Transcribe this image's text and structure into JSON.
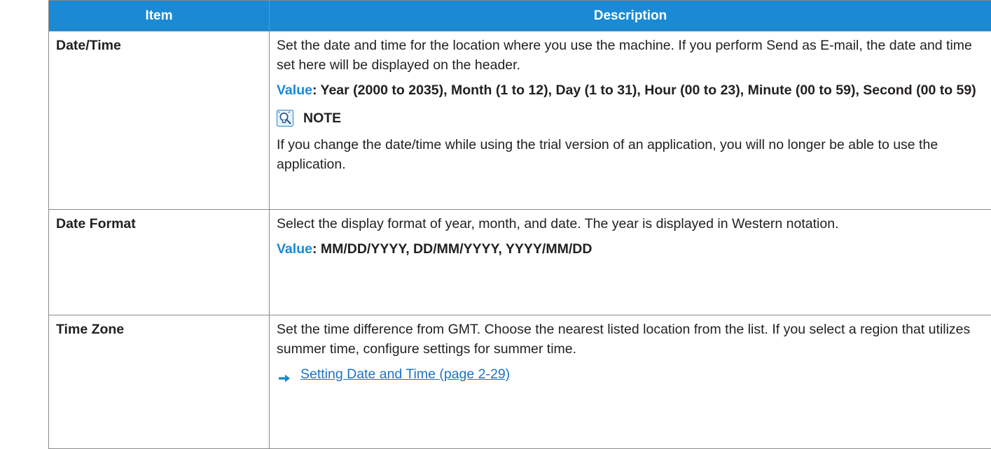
{
  "table": {
    "headers": {
      "item": "Item",
      "description": "Description"
    },
    "rows": [
      {
        "item": "Date/Time",
        "description": "Set the date and time for the location where you use the machine. If you perform Send as E-mail, the date and time set here will be displayed on the header.",
        "value_label": "Value",
        "value_text": ": Year (2000 to 2035), Month (1 to 12), Day (1 to 31), Hour (00 to 23), Minute (00 to 59), Second (00 to 59)",
        "note_title": "NOTE",
        "note_text": "If you change the date/time while using the trial version of an application, you will no longer be able to use the application."
      },
      {
        "item": "Date Format",
        "description": "Select the display format of year, month, and date. The year is displayed in Western notation.",
        "value_label": "Value",
        "value_text": ": MM/DD/YYYY, DD/MM/YYYY, YYYY/MM/DD"
      },
      {
        "item": "Time Zone",
        "description": "Set the time difference from GMT. Choose the nearest listed location from the list. If you select a region that utilizes summer time, configure settings for summer time.",
        "link_text": "Setting Date and Time (page 2-29)"
      }
    ]
  },
  "icons": {
    "note": "note-lightbulb-icon",
    "arrow": "arrow-right-icon"
  },
  "colors": {
    "header_bg": "#1a8ad4",
    "value_label": "#1a8ad4",
    "link": "#1a73c8",
    "border": "#8a8a8a"
  }
}
